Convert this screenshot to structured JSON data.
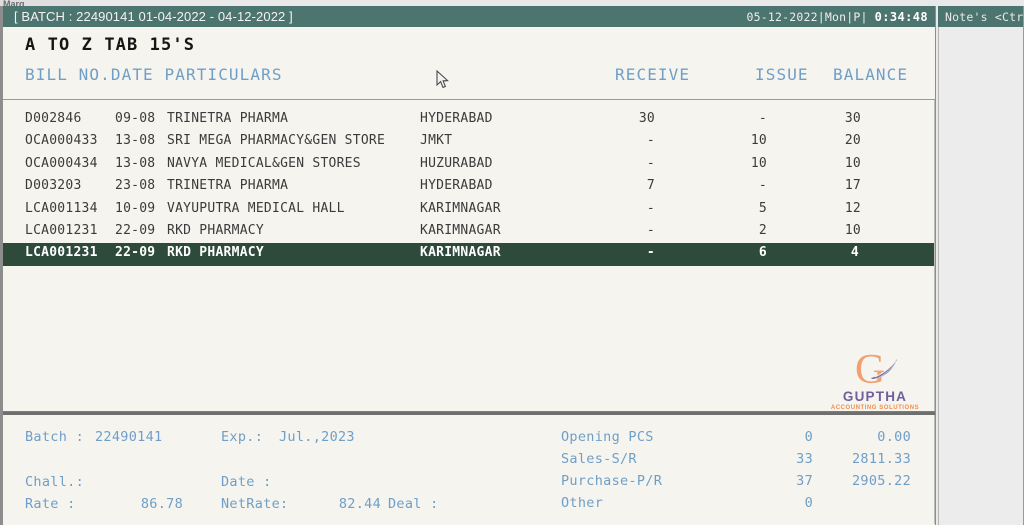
{
  "app": {
    "name": "Marg"
  },
  "titlebar": {
    "batch_title": "[ BATCH : 22490141 01-04-2022 - 04-12-2022 ]",
    "clock_date": "05-12-2022|Mon|P|",
    "clock_time": "0:34:48"
  },
  "header": {
    "item_title": "A TO Z TAB 15'S",
    "columns": {
      "left": "BILL NO.DATE PARTICULARS",
      "receive": "RECEIVE",
      "issue": "ISSUE",
      "balance": "BALANCE"
    }
  },
  "ledger": {
    "rows": [
      {
        "bill": "D002846",
        "date": "09-08",
        "particulars": "TRINETRA PHARMA",
        "place": "HYDERABAD",
        "receive": "30",
        "issue": "-",
        "balance": "30",
        "selected": false
      },
      {
        "bill": "OCA000433",
        "date": "13-08",
        "particulars": "SRI MEGA PHARMACY&GEN STORE",
        "place": "JMKT",
        "receive": "-",
        "issue": "10",
        "balance": "20",
        "selected": false
      },
      {
        "bill": "OCA000434",
        "date": "13-08",
        "particulars": "NAVYA MEDICAL&GEN STORES",
        "place": "HUZURABAD",
        "receive": "-",
        "issue": "10",
        "balance": "10",
        "selected": false
      },
      {
        "bill": "D003203",
        "date": "23-08",
        "particulars": "TRINETRA PHARMA",
        "place": "HYDERABAD",
        "receive": "7",
        "issue": "-",
        "balance": "17",
        "selected": false
      },
      {
        "bill": "LCA001134",
        "date": "10-09",
        "particulars": "VAYUPUTRA MEDICAL HALL",
        "place": "KARIMNAGAR",
        "receive": "-",
        "issue": "5",
        "balance": "12",
        "selected": false
      },
      {
        "bill": "LCA001231",
        "date": "22-09",
        "particulars": "RKD PHARMACY",
        "place": "KARIMNAGAR",
        "receive": "-",
        "issue": "2",
        "balance": "10",
        "selected": false
      },
      {
        "bill": "LCA001231",
        "date": "22-09",
        "particulars": "RKD PHARMACY",
        "place": "KARIMNAGAR",
        "receive": "-",
        "issue": "6",
        "balance": "4",
        "selected": true
      }
    ]
  },
  "logo": {
    "letter": "G",
    "name": "GUPTHA",
    "tagline": "ACCOUNTING SOLUTIONS",
    "letter_color": "#f0a071",
    "name_color": "#6f5f9e",
    "tagline_color": "#ef8f4e"
  },
  "summary": {
    "batch_label": "Batch :",
    "batch_value": "22490141",
    "exp_label": "Exp.:",
    "exp_value": "Jul.,2023",
    "chall_label": "Chall.:",
    "date_label": "Date   :",
    "date_value": "",
    "rate_label": "Rate   :",
    "rate_value": "86.78",
    "netrate_label": "NetRate:",
    "netrate_value": "82.44",
    "deal_label": "Deal :",
    "deal_value": "",
    "stock": [
      {
        "label": "Opening  PCS",
        "qty": "0",
        "amount": "0.00"
      },
      {
        "label": "Sales-S/R",
        "qty": "33",
        "amount": "2811.33"
      },
      {
        "label": "Purchase-P/R",
        "qty": "37",
        "amount": "2905.22"
      },
      {
        "label": "Other",
        "qty": "0",
        "amount": ""
      }
    ]
  },
  "notes": {
    "header": "Note's <Ctrl"
  },
  "colors": {
    "titlebar": "#4d7570",
    "selected_row": "#2d4a3b",
    "label_blue": "#6f9fc7",
    "page_bg": "#f5f4ef"
  }
}
